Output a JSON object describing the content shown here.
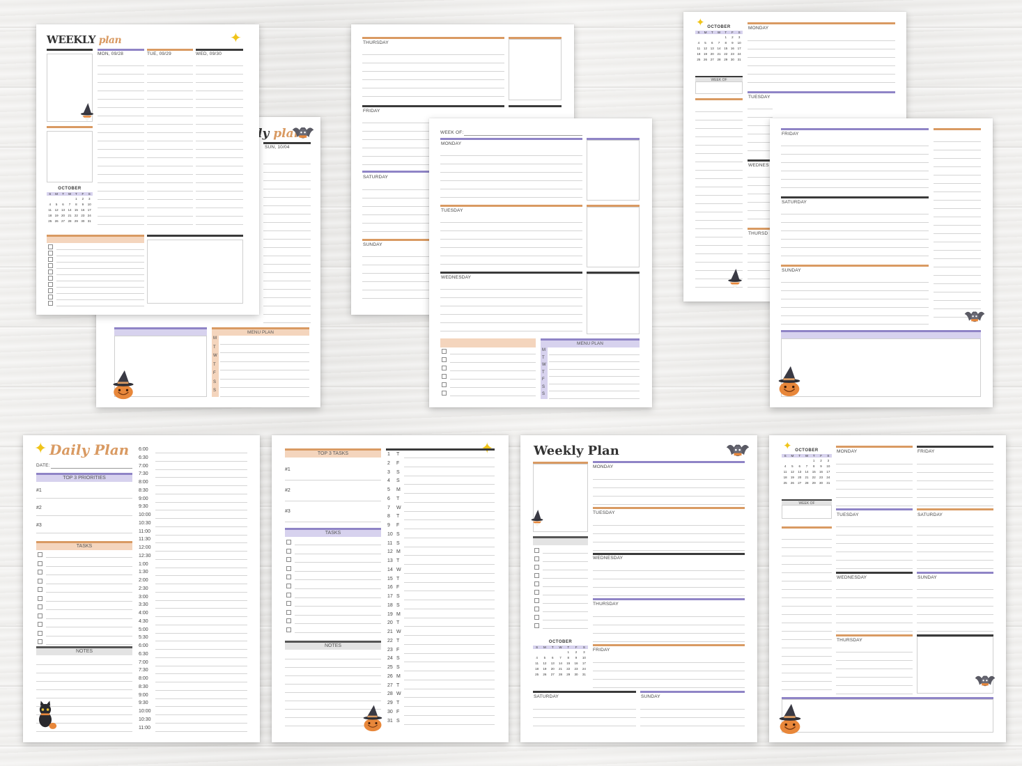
{
  "weekly_top_left": {
    "title_a": "WEEKLY",
    "title_b": "plan",
    "days": [
      "MON, 09/28",
      "TUE, 09/29",
      "WED, 09/30"
    ],
    "calendar_month": "OCTOBER",
    "dow": [
      "S",
      "M",
      "T",
      "W",
      "T",
      "F",
      "S"
    ],
    "dates": [
      "",
      "",
      "",
      "",
      "1",
      "2",
      "3",
      "4",
      "5",
      "6",
      "7",
      "8",
      "9",
      "10",
      "11",
      "12",
      "13",
      "14",
      "15",
      "16",
      "17",
      "18",
      "19",
      "20",
      "21",
      "22",
      "23",
      "24",
      "25",
      "26",
      "27",
      "28",
      "29",
      "30",
      "31"
    ]
  },
  "weekly_top_left_back": {
    "title_frag_a": "ly",
    "title_frag_b": "plan",
    "day": "SUN, 10/04",
    "menu_plan": "MENU PLAN",
    "menu_days": [
      "M",
      "T",
      "W",
      "T",
      "F",
      "S",
      "S"
    ]
  },
  "weekly_center_back": {
    "days": [
      "THURSDAY",
      "FRIDAY",
      "SATURDAY",
      "SUNDAY"
    ]
  },
  "weekly_center_front": {
    "week_of": "WEEK OF:",
    "days": [
      "MONDAY",
      "TUESDAY",
      "WEDNESDAY"
    ],
    "menu_plan": "MENU PLAN",
    "menu_days": [
      "M",
      "T",
      "W",
      "T",
      "F",
      "S",
      "S"
    ]
  },
  "weekly_right_back": {
    "calendar_month": "OCTOBER",
    "week_of": "WEEK OF",
    "days": [
      "MONDAY",
      "TUESDAY",
      "WEDNES",
      "THURSD"
    ]
  },
  "weekly_right_front": {
    "days": [
      "FRIDAY",
      "SATURDAY",
      "SUNDAY"
    ]
  },
  "daily_plan": {
    "title": "Daily Plan",
    "date_label": "DATE:",
    "top3": "TOP 3 PRIORITIES",
    "priorities": [
      "#1",
      "#2",
      "#3"
    ],
    "tasks": "TASKS",
    "notes": "NOTES",
    "times": [
      "6:00",
      "6:30",
      "7:00",
      "7:30",
      "8:00",
      "8:30",
      "9:00",
      "9:30",
      "10:00",
      "10:30",
      "11:00",
      "11:30",
      "12:00",
      "12:30",
      "1:00",
      "1:30",
      "2:00",
      "2:30",
      "3:00",
      "3:30",
      "4:00",
      "4:30",
      "5:00",
      "5:30",
      "6:00",
      "6:30",
      "7:00",
      "7:30",
      "8:00",
      "8:30",
      "9:00",
      "9:30",
      "10:00",
      "10:30",
      "11:00"
    ]
  },
  "monthly_tasks": {
    "top3": "TOP 3 TASKS",
    "items": [
      "#1",
      "#2",
      "#3"
    ],
    "tasks": "TASKS",
    "notes": "NOTES",
    "day_numbers": [
      "1",
      "2",
      "3",
      "4",
      "5",
      "6",
      "7",
      "8",
      "9",
      "10",
      "11",
      "12",
      "13",
      "14",
      "15",
      "16",
      "17",
      "18",
      "19",
      "20",
      "21",
      "22",
      "23",
      "24",
      "25",
      "26",
      "27",
      "28",
      "29",
      "30",
      "31"
    ],
    "day_letters": [
      "T",
      "F",
      "S",
      "S",
      "M",
      "T",
      "W",
      "T",
      "F",
      "S",
      "S",
      "M",
      "T",
      "W",
      "T",
      "F",
      "S",
      "S",
      "M",
      "T",
      "W",
      "T",
      "F",
      "S",
      "S",
      "M",
      "T",
      "W",
      "T",
      "F",
      "S"
    ]
  },
  "weekly_plan_bottom": {
    "title": "Weekly Plan",
    "days": [
      "MONDAY",
      "TUESDAY",
      "WEDNESDAY",
      "THURSDAY",
      "FRIDAY",
      "SATURDAY",
      "SUNDAY"
    ],
    "calendar_month": "OCTOBER"
  },
  "weekly_grid_bottom": {
    "calendar_month": "OCTOBER",
    "week_of": "WEEK OF",
    "days": [
      "MONDAY",
      "FRIDAY",
      "TUESDAY",
      "SATURDAY",
      "WEDNESDAY",
      "SUNDAY",
      "THURSDAY"
    ]
  },
  "colors": {
    "orange": "#d99a62",
    "purple": "#8f84c6",
    "dark": "#3a3a3a",
    "peach_header": "#f4d5bd",
    "lavender_header": "#d7d2ee"
  }
}
